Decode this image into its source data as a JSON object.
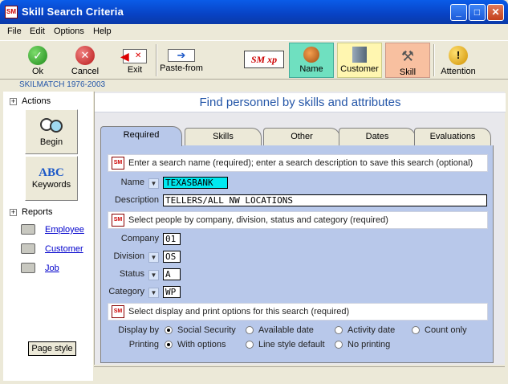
{
  "window": {
    "title": "Skill Search Criteria"
  },
  "menu": [
    "File",
    "Edit",
    "Options",
    "Help"
  ],
  "toolbar": {
    "ok": "Ok",
    "cancel": "Cancel",
    "exit": "Exit",
    "paste_from": "Paste-from",
    "logo": "SM xp",
    "name": "Name",
    "customer": "Customer",
    "skill": "Skill",
    "attention": "Attention"
  },
  "brand": "SKILMATCH 1976-2003",
  "sidebar": {
    "actions": "Actions",
    "begin": "Begin",
    "keywords": "Keywords",
    "reports": "Reports",
    "employee": "Employee",
    "customer": "Customer",
    "job": "Job",
    "page_style": "Page style"
  },
  "main": {
    "heading": "Find personnel by skills and attributes"
  },
  "tabs": [
    "Required",
    "Skills",
    "Other",
    "Dates",
    "Evaluations"
  ],
  "sections": {
    "s1": "Enter a search name (required); enter a search description to save this search (optional)",
    "s2": "Select people by company, division, status and category (required)",
    "s3": "Select display and print options for this search (required)"
  },
  "fields": {
    "name_label": "Name",
    "name_value": "TEXASBANK",
    "desc_label": "Description",
    "desc_value": "TELLERS/ALL NW LOCATIONS",
    "company_label": "Company",
    "company_value": "01",
    "division_label": "Division",
    "division_value": "OS",
    "status_label": "Status",
    "status_value": "A",
    "category_label": "Category",
    "category_value": "WP"
  },
  "display": {
    "label": "Display by",
    "options": [
      "Social Security",
      "Available date",
      "Activity date",
      "Count only"
    ],
    "selected": 0
  },
  "printing": {
    "label": "Printing",
    "options": [
      "With options",
      "Line style default",
      "No printing"
    ],
    "selected": 0
  },
  "colors": {
    "title": "#0a5ce8",
    "panel": "#b8c8ea",
    "highlight": "#00e8f0"
  }
}
